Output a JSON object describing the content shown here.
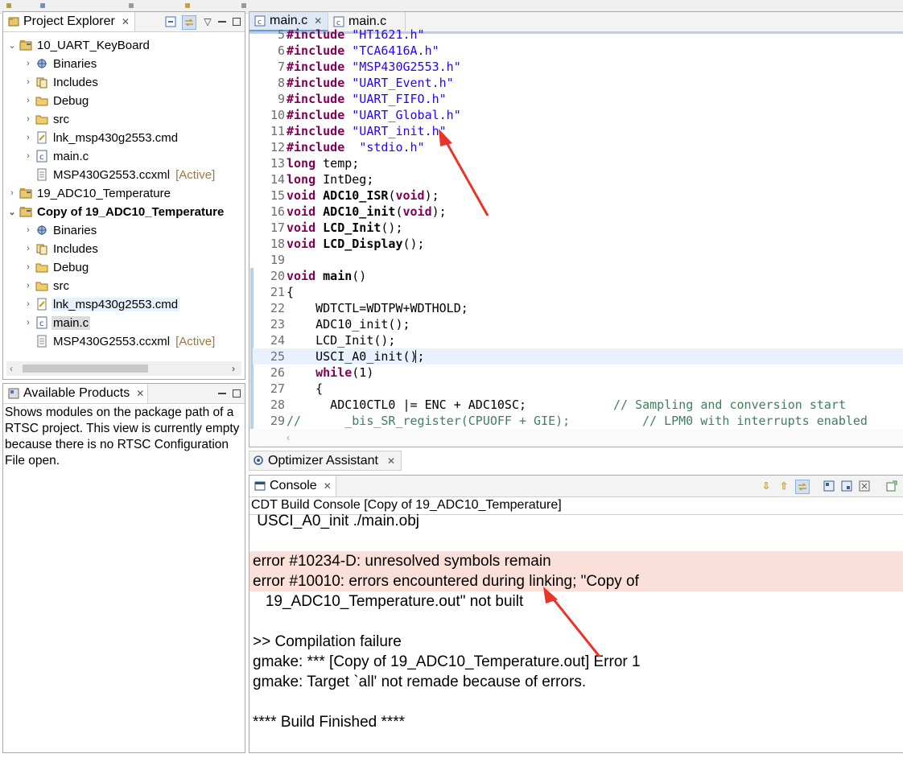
{
  "explorer": {
    "title": "Project Explorer",
    "items": [
      {
        "label": "10_UART_KeyBoard",
        "tag": "",
        "icon": "project-icon"
      },
      {
        "label": "Binaries",
        "tag": "",
        "icon": "binaries-icon"
      },
      {
        "label": "Includes",
        "tag": "",
        "icon": "includes-icon"
      },
      {
        "label": "Debug",
        "tag": "",
        "icon": "folder-icon"
      },
      {
        "label": "src",
        "tag": "",
        "icon": "folder-icon"
      },
      {
        "label": "lnk_msp430g2553.cmd",
        "tag": "",
        "icon": "cmd-file-icon"
      },
      {
        "label": "main.c",
        "tag": "",
        "icon": "c-file-icon"
      },
      {
        "label": "MSP430G2553.ccxml",
        "tag": "[Active]",
        "icon": "ccxml-file-icon"
      },
      {
        "label": "19_ADC10_Temperature",
        "tag": "",
        "icon": "project-icon"
      },
      {
        "label": "Copy of 19_ADC10_Temperature",
        "tag": "",
        "icon": "project-icon"
      },
      {
        "label": "Binaries",
        "tag": "",
        "icon": "binaries-icon"
      },
      {
        "label": "Includes",
        "tag": "",
        "icon": "includes-icon"
      },
      {
        "label": "Debug",
        "tag": "",
        "icon": "folder-icon"
      },
      {
        "label": "src",
        "tag": "",
        "icon": "folder-icon"
      },
      {
        "label": "lnk_msp430g2553.cmd",
        "tag": "",
        "icon": "cmd-file-icon"
      },
      {
        "label": "main.c",
        "tag": "",
        "icon": "c-file-icon"
      },
      {
        "label": "MSP430G2553.ccxml",
        "tag": "[Active]",
        "icon": "ccxml-file-icon"
      }
    ]
  },
  "products": {
    "title": "Available Products",
    "text": "Shows modules on the package path of a RTSC project. This view is currently empty because there is no RTSC Configuration File open."
  },
  "editor": {
    "tabs": [
      "main.c",
      "main.c"
    ],
    "lines": [
      {
        "n": "5",
        "t": "#include \"HT1621.h\""
      },
      {
        "n": "6",
        "t": "#include \"TCA6416A.h\""
      },
      {
        "n": "7",
        "t": "#include \"MSP430G2553.h\""
      },
      {
        "n": "8",
        "t": "#include \"UART_Event.h\""
      },
      {
        "n": "9",
        "t": "#include \"UART_FIFO.h\""
      },
      {
        "n": "10",
        "t": "#include \"UART_Global.h\""
      },
      {
        "n": "11",
        "t": "#include \"UART_init.h\""
      },
      {
        "n": "12",
        "t": "#include  \"stdio.h\""
      },
      {
        "n": "13",
        "t": "long temp;"
      },
      {
        "n": "14",
        "t": "long IntDeg;"
      },
      {
        "n": "15",
        "t": "void ADC10_ISR(void);"
      },
      {
        "n": "16",
        "t": "void ADC10_init(void);"
      },
      {
        "n": "17",
        "t": "void LCD_Init();"
      },
      {
        "n": "18",
        "t": "void LCD_Display();"
      },
      {
        "n": "19",
        "t": ""
      },
      {
        "n": "20",
        "t": "void main()"
      },
      {
        "n": "21",
        "t": "{"
      },
      {
        "n": "22",
        "t": "    WDTCTL=WDTPW+WDTHOLD;"
      },
      {
        "n": "23",
        "t": "    ADC10_init();"
      },
      {
        "n": "24",
        "t": "    LCD_Init();"
      },
      {
        "n": "25",
        "t": "    USCI_A0_init();"
      },
      {
        "n": "26",
        "t": "    while(1)"
      },
      {
        "n": "27",
        "t": "    {"
      },
      {
        "n": "28",
        "t": "      ADC10CTL0 |= ENC + ADC10SC;"
      },
      {
        "n": "29",
        "t": "//      _bis_SR_register(CPUOFF + GIE);"
      }
    ],
    "comment28": "// Sampling and conversion start",
    "comment29": "// LPM0 with interrupts enabled"
  },
  "optimizer": {
    "title": "Optimizer Assistant"
  },
  "console": {
    "title": "Console",
    "subtitle": "CDT Build Console [Copy of 19_ADC10_Temperature]",
    "lines": [
      " USCI_A0_init ./main.obj",
      "",
      "error #10234-D: unresolved symbols remain",
      "error #10010: errors encountered during linking; \"Copy of",
      "   19_ADC10_Temperature.out\" not built",
      "",
      ">> Compilation failure",
      "gmake: *** [Copy of 19_ADC10_Temperature.out] Error 1",
      "gmake: Target `all' not remade because of errors.",
      "",
      "**** Build Finished ****"
    ]
  },
  "colors": {
    "annotation_arrow": "#e8352a",
    "error_bg": "#fbdfd9",
    "keyword": "#7f0055",
    "string": "#2a00ff",
    "comment": "#3f7f5f"
  }
}
